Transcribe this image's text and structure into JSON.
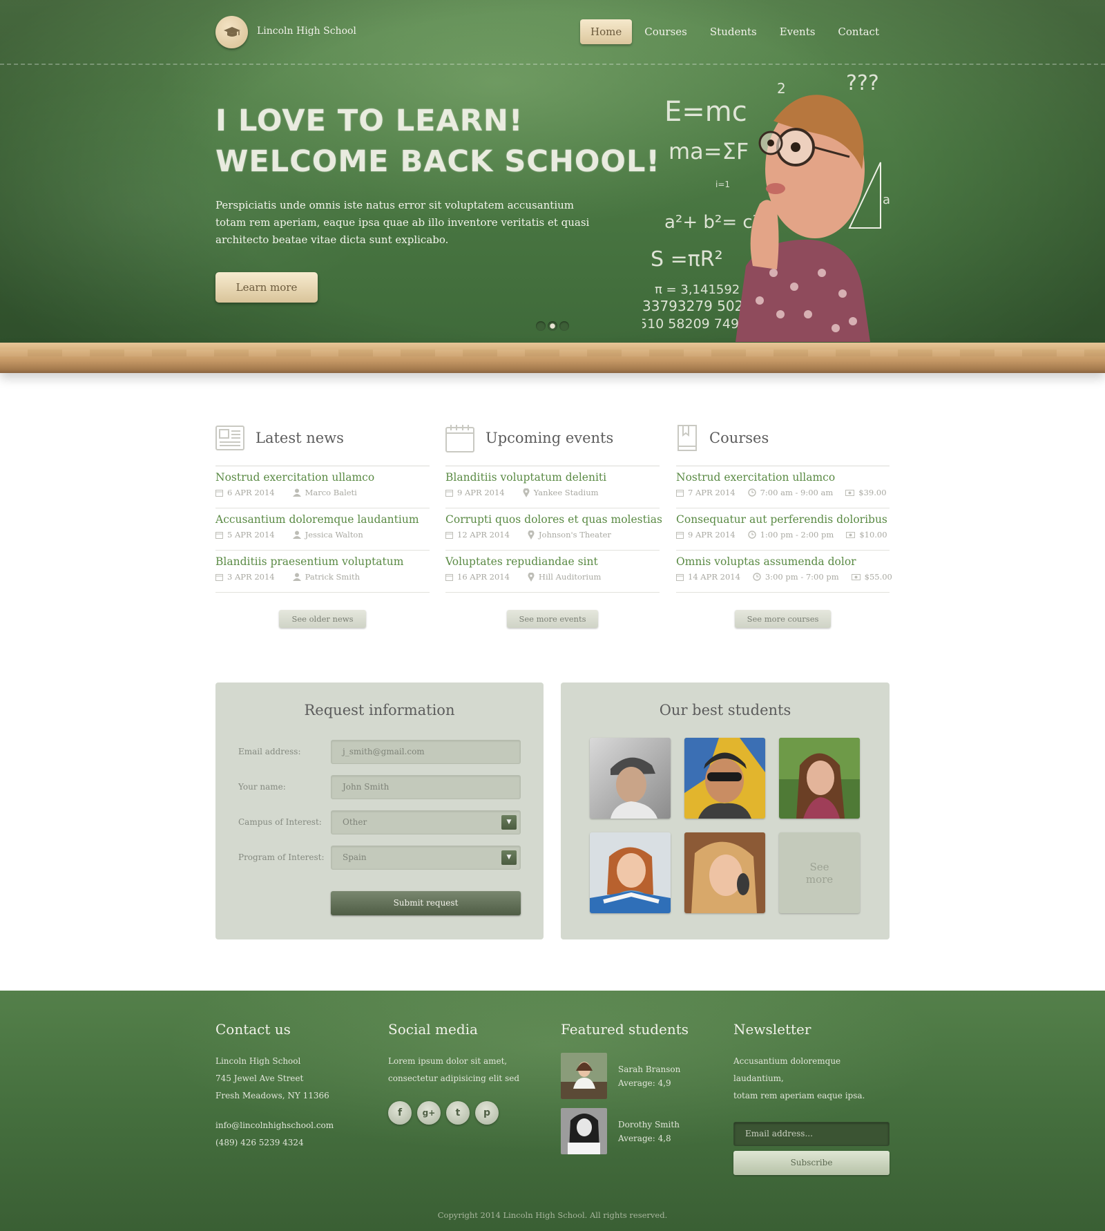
{
  "header": {
    "site_name": "Lincoln High School",
    "nav": [
      "Home",
      "Courses",
      "Students",
      "Events",
      "Contact"
    ],
    "active_nav": "Home"
  },
  "hero": {
    "title_line1": "I LOVE TO LEARN!",
    "title_line2": "WELCOME BACK SCHOOL!",
    "text": "Perspiciatis unde omnis iste natus error sit voluptatem accusantium totam rem aperiam, eaque ipsa quae ab illo inventore veritatis et quasi architecto beatae vitae dicta sunt explicabo.",
    "button": "Learn more",
    "slide_count": 3,
    "active_slide": 2,
    "chalk": {
      "e": "E=mc",
      "two": "2",
      "q": "???",
      "ma": "ma=ΣF",
      "sub": "i=1",
      "pyth": "a²+ b²= c²",
      "area": "S =πR²",
      "pi1": "π = 3,141592",
      "pi2": "33793279 502",
      "pi3": "510 58209 7494",
      "tri_c": "c",
      "tri_a": "a"
    }
  },
  "news": {
    "title": "Latest news",
    "items": [
      {
        "title": "Nostrud exercitation ullamco",
        "date": "6 APR 2014",
        "author": "Marco Baleti"
      },
      {
        "title": "Accusantium doloremque laudantium",
        "date": "5 APR 2014",
        "author": "Jessica Walton"
      },
      {
        "title": "Blanditiis praesentium voluptatum",
        "date": "3 APR 2014",
        "author": "Patrick Smith"
      }
    ],
    "button": "See older news"
  },
  "events": {
    "title": "Upcoming events",
    "items": [
      {
        "title": "Blanditiis voluptatum deleniti",
        "date": "9 APR 2014",
        "place": "Yankee Stadium"
      },
      {
        "title": "Corrupti quos dolores et quas molestias",
        "date": "12 APR 2014",
        "place": "Johnson's Theater"
      },
      {
        "title": "Voluptates repudiandae sint",
        "date": "16 APR 2014",
        "place": "Hill Auditorium"
      }
    ],
    "button": "See more events"
  },
  "courses": {
    "title": "Courses",
    "items": [
      {
        "title": "Nostrud exercitation ullamco",
        "date": "7 APR 2014",
        "time": "7:00 am - 9:00 am",
        "price": "$39.00"
      },
      {
        "title": "Consequatur aut perferendis doloribus",
        "date": "9 APR 2014",
        "time": "1:00 pm - 2:00 pm",
        "price": "$10.00"
      },
      {
        "title": "Omnis voluptas assumenda dolor",
        "date": "14 APR 2014",
        "time": "3:00 pm - 7:00 pm",
        "price": "$55.00"
      }
    ],
    "button": "See more courses"
  },
  "request": {
    "title": "Request information",
    "fields": [
      {
        "label": "Email address:",
        "value": "j_smith@gmail.com"
      },
      {
        "label": "Your name:",
        "value": "John Smith"
      },
      {
        "label": "Campus of Interest:",
        "value": "Other"
      },
      {
        "label": "Program of Interest:",
        "value": "Spain"
      }
    ],
    "submit": "Submit request"
  },
  "students": {
    "title": "Our best students",
    "see_more_line1": "See",
    "see_more_line2": "more"
  },
  "footer": {
    "contact": {
      "title": "Contact us",
      "line1": "Lincoln High School",
      "line2": "745 Jewel Ave Street",
      "line3": "Fresh Meadows, NY 11366",
      "email": "info@lincolnhighschool.com",
      "phone": "(489) 426 5239 4324"
    },
    "social": {
      "title": "Social media",
      "line1": "Lorem ipsum dolor sit amet,",
      "line2": "consectetur adipisicing elit sed",
      "icons": [
        "facebook-icon",
        "google-plus-icon",
        "twitter-icon",
        "pinterest-icon"
      ],
      "glyphs": [
        "f",
        "g+",
        "t",
        "p"
      ]
    },
    "featured": {
      "title": "Featured students",
      "students": [
        {
          "name": "Sarah Branson",
          "average": "Average: 4,9"
        },
        {
          "name": "Dorothy Smith",
          "average": "Average: 4,8"
        }
      ]
    },
    "newsletter": {
      "title": "Newsletter",
      "line1": "Accusantium doloremque laudantium,",
      "line2": "totam rem aperiam eaque ipsa.",
      "placeholder": "Email address...",
      "button": "Subscribe"
    },
    "copyright": "Copyright 2014 Lincoln High School. All rights reserved."
  },
  "colors": {
    "chalkboard": "#4c7a44",
    "link_green": "#5a8a44",
    "panel": "#d4d9cf",
    "accent_beige": "#e8d6b0"
  }
}
